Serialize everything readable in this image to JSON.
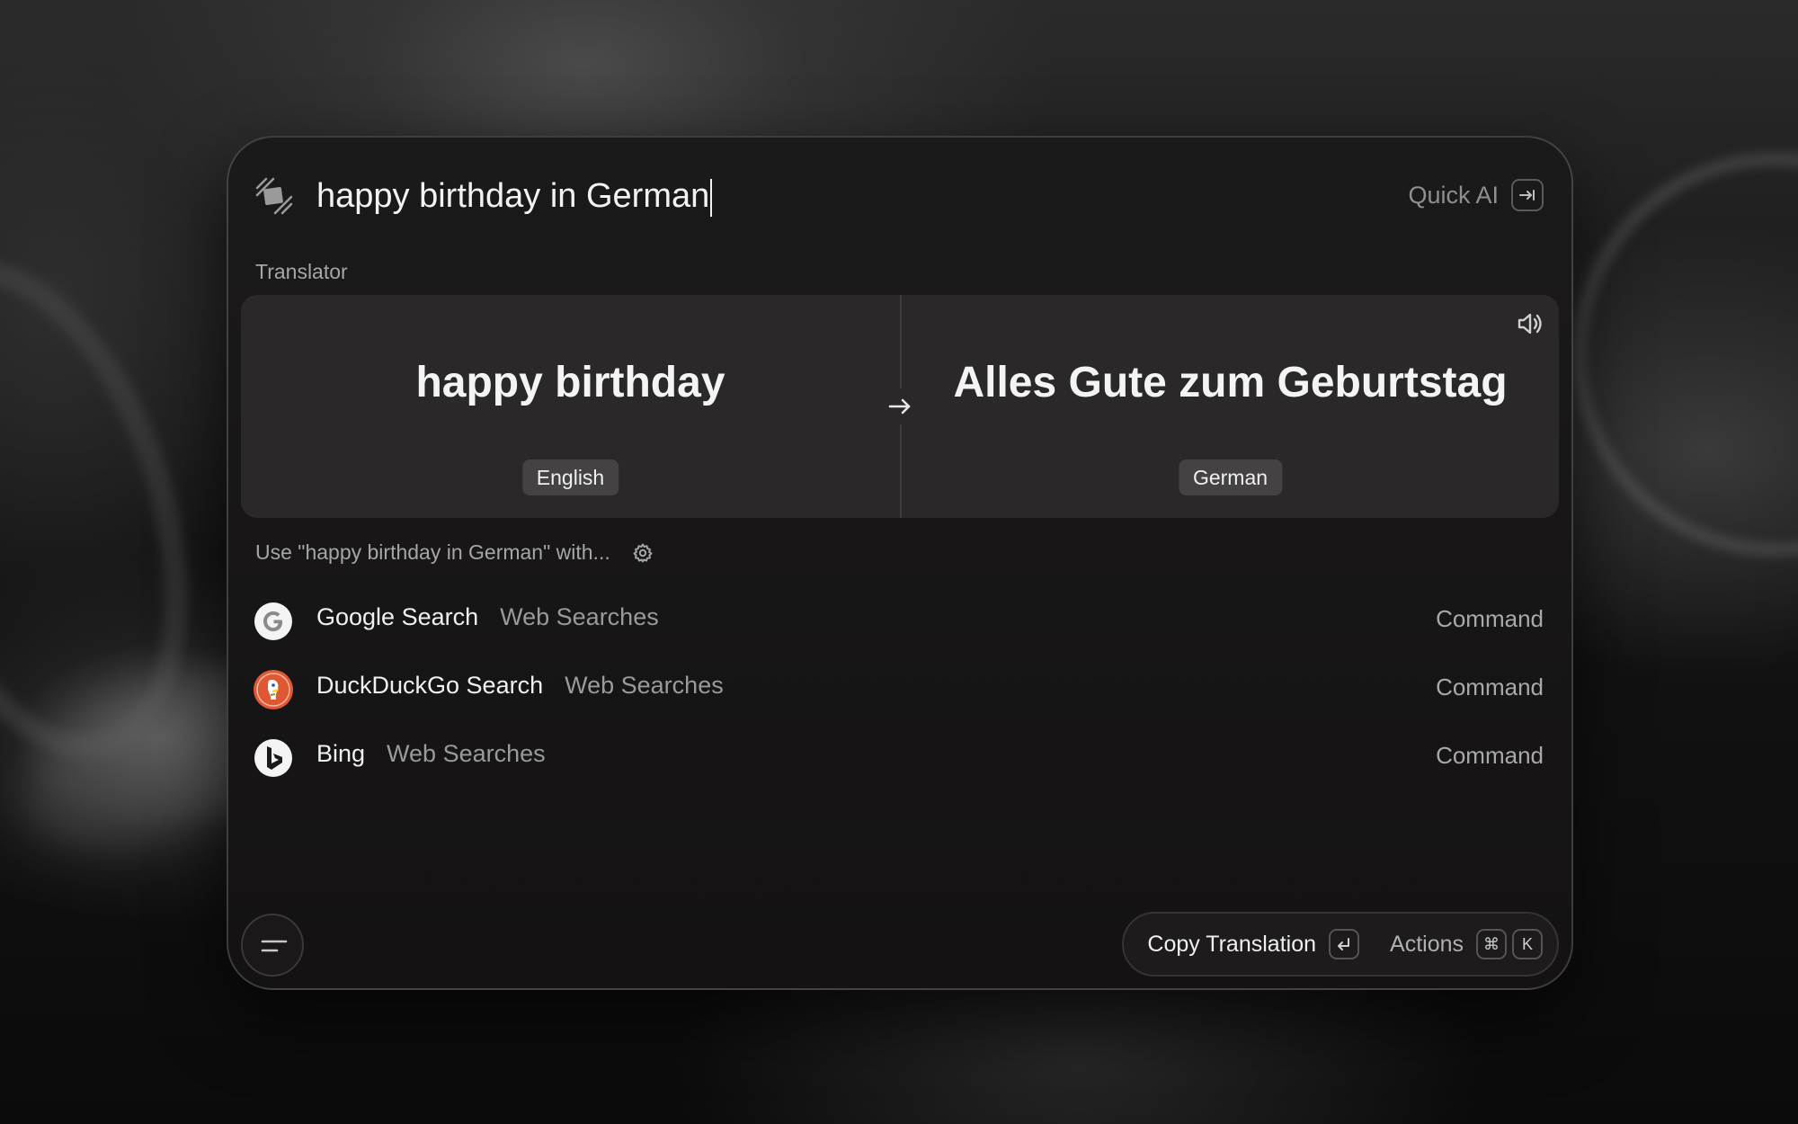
{
  "search": {
    "query": "happy birthday in German",
    "quick_ai_label": "Quick AI",
    "quick_ai_key": "⇥"
  },
  "translator": {
    "section_label": "Translator",
    "source_text": "happy birthday",
    "source_language": "English",
    "target_text": "Alles Gute zum Geburtstag",
    "target_language": "German"
  },
  "fallback": {
    "heading": "Use \"happy birthday in German\" with...",
    "items": [
      {
        "title": "Google Search",
        "subtitle": "Web Searches",
        "kind": "Command",
        "icon": "google-icon"
      },
      {
        "title": "DuckDuckGo Search",
        "subtitle": "Web Searches",
        "kind": "Command",
        "icon": "duckduckgo-icon"
      },
      {
        "title": "Bing",
        "subtitle": "Web Searches",
        "kind": "Command",
        "icon": "bing-icon"
      }
    ]
  },
  "action_bar": {
    "primary_label": "Copy Translation",
    "primary_key": "↵",
    "actions_label": "Actions",
    "actions_keys": [
      "⌘",
      "K"
    ]
  },
  "colors": {
    "panel_bg": "#171515",
    "card_bg": "#2a2828",
    "text_primary": "#f0f0f0",
    "text_muted": "#a6a6a6",
    "duckduckgo": "#de5833"
  }
}
